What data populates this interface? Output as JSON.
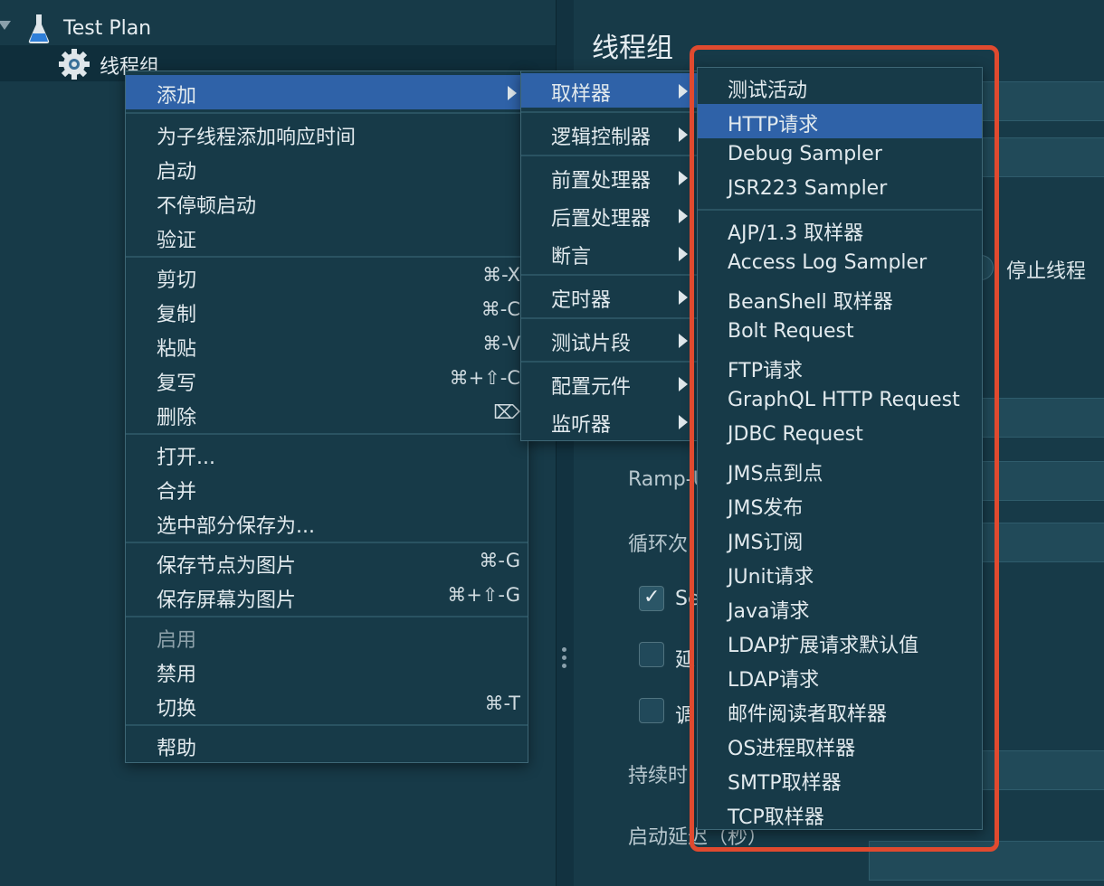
{
  "tree": {
    "root_label": "Test Plan",
    "child_label": "线程组"
  },
  "editor": {
    "title": "线程组",
    "stop_thread_label": "停止线程",
    "ramp_up_label": "Ramp-U",
    "loop_label": "循环次",
    "checkbox_1_label": "Se",
    "checkbox_2_label": "延",
    "checkbox_3_label": "调",
    "duration_label": "持续时",
    "startup_delay_label": "启动延迟（秒）"
  },
  "context_menu": {
    "items": [
      {
        "label": "添加",
        "shortcut": "",
        "has_submenu": true
      },
      {
        "label": "为子线程添加响应时间",
        "shortcut": ""
      },
      {
        "label": "启动",
        "shortcut": ""
      },
      {
        "label": "不停顿启动",
        "shortcut": ""
      },
      {
        "label": "验证",
        "shortcut": ""
      },
      {
        "label": "剪切",
        "shortcut": "⌘-X"
      },
      {
        "label": "复制",
        "shortcut": "⌘-C"
      },
      {
        "label": "粘贴",
        "shortcut": "⌘-V"
      },
      {
        "label": "复写",
        "shortcut": "⌘+⇧-C"
      },
      {
        "label": "删除",
        "shortcut": "⌦"
      },
      {
        "label": "打开...",
        "shortcut": ""
      },
      {
        "label": "合并",
        "shortcut": ""
      },
      {
        "label": "选中部分保存为...",
        "shortcut": ""
      },
      {
        "label": "保存节点为图片",
        "shortcut": "⌘-G"
      },
      {
        "label": "保存屏幕为图片",
        "shortcut": "⌘+⇧-G"
      },
      {
        "label": "启用",
        "shortcut": "",
        "disabled": true
      },
      {
        "label": "禁用",
        "shortcut": ""
      },
      {
        "label": "切换",
        "shortcut": "⌘-T"
      },
      {
        "label": "帮助",
        "shortcut": ""
      }
    ]
  },
  "add_submenu": {
    "items": [
      {
        "label": "取样器"
      },
      {
        "label": "逻辑控制器"
      },
      {
        "label": "前置处理器"
      },
      {
        "label": "后置处理器"
      },
      {
        "label": "断言"
      },
      {
        "label": "定时器"
      },
      {
        "label": "测试片段"
      },
      {
        "label": "配置元件"
      },
      {
        "label": "监听器"
      }
    ]
  },
  "sampler_submenu": {
    "items": [
      {
        "label": "测试活动"
      },
      {
        "label": "HTTP请求"
      },
      {
        "label": "Debug Sampler"
      },
      {
        "label": "JSR223 Sampler"
      },
      {
        "label": "AJP/1.3 取样器"
      },
      {
        "label": "Access Log Sampler"
      },
      {
        "label": "BeanShell 取样器"
      },
      {
        "label": "Bolt Request"
      },
      {
        "label": "FTP请求"
      },
      {
        "label": "GraphQL HTTP Request"
      },
      {
        "label": "JDBC Request"
      },
      {
        "label": "JMS点到点"
      },
      {
        "label": "JMS发布"
      },
      {
        "label": "JMS订阅"
      },
      {
        "label": "JUnit请求"
      },
      {
        "label": "Java请求"
      },
      {
        "label": "LDAP扩展请求默认值"
      },
      {
        "label": "LDAP请求"
      },
      {
        "label": "邮件阅读者取样器"
      },
      {
        "label": "OS进程取样器"
      },
      {
        "label": "SMTP取样器"
      },
      {
        "label": "TCP取样器"
      }
    ]
  },
  "colors": {
    "background": "#173a48",
    "menu_highlight": "#2f62a8",
    "annotation_frame": "#e04a2f"
  }
}
